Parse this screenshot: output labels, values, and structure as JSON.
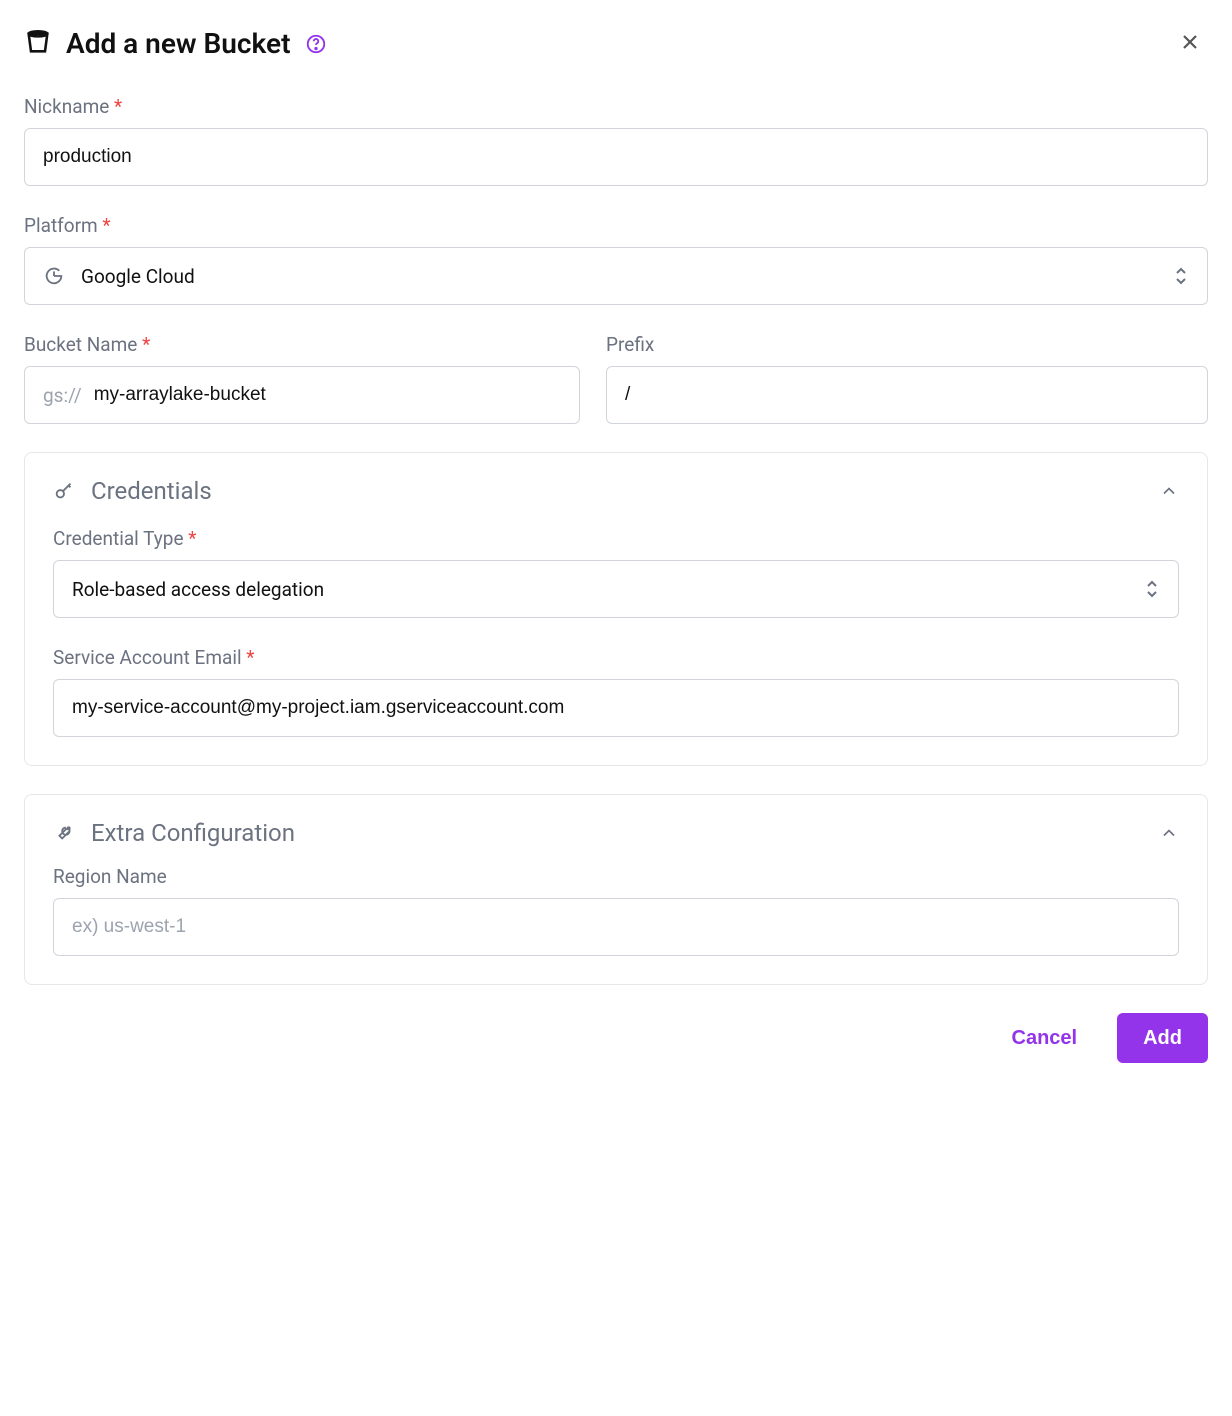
{
  "header": {
    "title": "Add a new Bucket"
  },
  "fields": {
    "nickname": {
      "label": "Nickname",
      "value": "production"
    },
    "platform": {
      "label": "Platform",
      "selected": "Google Cloud"
    },
    "bucket_name": {
      "label": "Bucket Name",
      "scheme": "gs://",
      "value": "my-arraylake-bucket"
    },
    "prefix": {
      "label": "Prefix",
      "value": "/"
    }
  },
  "credentials": {
    "title": "Credentials",
    "type": {
      "label": "Credential Type",
      "selected": "Role-based access delegation"
    },
    "service_account": {
      "label": "Service Account Email",
      "value": "my-service-account@my-project.iam.gserviceaccount.com"
    }
  },
  "extra": {
    "title": "Extra Configuration",
    "region": {
      "label": "Region Name",
      "placeholder": "ex) us-west-1",
      "value": ""
    }
  },
  "buttons": {
    "cancel": "Cancel",
    "add": "Add"
  }
}
